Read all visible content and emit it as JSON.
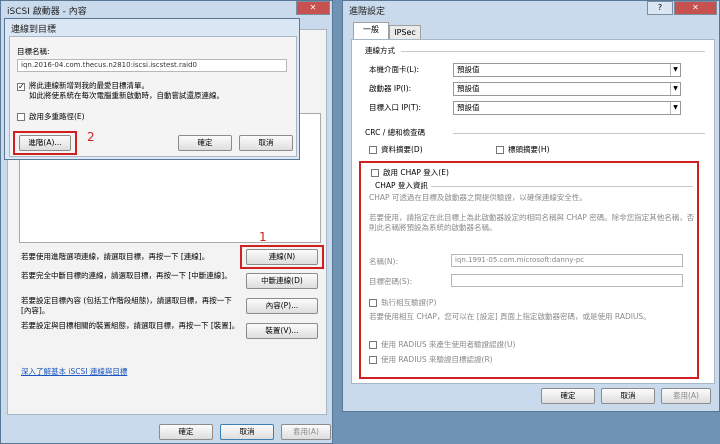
{
  "left_window": {
    "title": "iSCSI 啟動器 - 內容",
    "connect_label": "若要使用進階選項連線，請選取目標，再按一下 [連線]。",
    "connect_button": "連線(N)",
    "disconnect_label": "若要完全中斷目標的連線，請選取目標，再按一下 [中斷連線]。",
    "disconnect_button": "中斷連線(D)",
    "properties_label": "若要設定目標內容 (包括工作階段組態)，請選取目標，再按一下 [內容]。",
    "properties_button": "內容(P)...",
    "devices_label": "若要設定與目標相關的裝置組態，請選取目標，再按一下 [裝置]。",
    "devices_button": "裝置(V)...",
    "learn_more_link": "深入了解基本 iSCSI 連線與目標",
    "ok_button": "確定",
    "cancel_button": "取消",
    "apply_button": "套用(A)",
    "annotation_1": "1"
  },
  "connect_dialog": {
    "title": "連線到目標",
    "target_name_label": "目標名稱:",
    "target_name_value": "iqn.2016-04.com.thecus.n2810:iscsi.iscstest.raid0",
    "add_favorites_label": "將此連線新增到我的最愛目標清單。\n如此將使系統在每次電腦重新啟動時，自動嘗試還原連線。",
    "multipath_label": "啟用多重路徑(E)",
    "advanced_button": "進階(A)...",
    "ok_button": "確定",
    "cancel_button": "取消",
    "annotation_2": "2"
  },
  "advanced_window": {
    "title": "進階設定",
    "tabs": [
      "一般",
      "IPSec"
    ],
    "connect_using_header": "連線方式",
    "local_adapter_label": "本機介面卡(L):",
    "local_adapter_value": "預設值",
    "initiator_ip_label": "啟動器 IP(I):",
    "initiator_ip_value": "預設值",
    "target_portal_label": "目標入口 IP(T):",
    "target_portal_value": "預設值",
    "crc_header": "CRC / 總和檢查碼",
    "data_digest_label": "資料摘要(D)",
    "header_digest_label": "標頭摘要(H)",
    "chap_enable_label": "啟用 CHAP 登入(E)",
    "chap_info_header": "CHAP 登入資訊",
    "chap_desc": "CHAP 可透過在目標及啟動器之間提供驗證，以確保連線安全性。",
    "chap_instr": "若要使用，請指定在此目標上為此啟動器設定的相同名稱與 CHAP 密碼。除非您指定其他名稱，否則此名稱將預設為系統的啟動器名稱。",
    "name_label": "名稱(N):",
    "name_value": "iqn.1991-05.com.microsoft:danny-pc",
    "secret_label": "目標密碼(S):",
    "mutual_label": "執行相互驗證(P)",
    "mutual_desc": "若要使用相互 CHAP，您可以在 [設定] 頁面上指定啟動器密碼，或是使用 RADIUS。",
    "radius_user_label": "使用 RADIUS 來產生使用者驗證認證(U)",
    "radius_target_label": "使用 RADIUS 來驗證目標認證(R)",
    "ok_button": "確定",
    "cancel_button": "取消",
    "apply_button": "套用(A)"
  },
  "title_buttons": {
    "close": "✕",
    "question": "?"
  },
  "colors": {
    "annotation_red": "#d12020",
    "window_frame": "#c9daec"
  }
}
